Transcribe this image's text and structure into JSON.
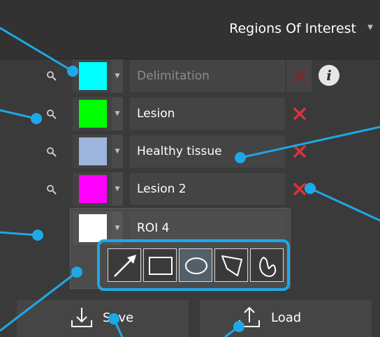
{
  "header": {
    "title": "Regions Of Interest"
  },
  "rows": [
    {
      "name": "Delimitation",
      "color": "#00ffff"
    },
    {
      "name": "Lesion",
      "color": "#00ff00"
    },
    {
      "name": "Healthy tissue",
      "color": "#9db4dc"
    },
    {
      "name": "Lesion 2",
      "color": "#ff00ff"
    },
    {
      "name": "ROI 4",
      "color": "#ffffff"
    }
  ],
  "tools": [
    "arrow-tool",
    "rectangle-tool",
    "ellipse-tool",
    "polygon-tool",
    "freehand-tool"
  ],
  "buttons": {
    "save": "Save",
    "load": "Load"
  },
  "colors": {
    "accent": "#1ea8e8",
    "delete": "#e0303a",
    "panel": "#3a3a3a"
  }
}
